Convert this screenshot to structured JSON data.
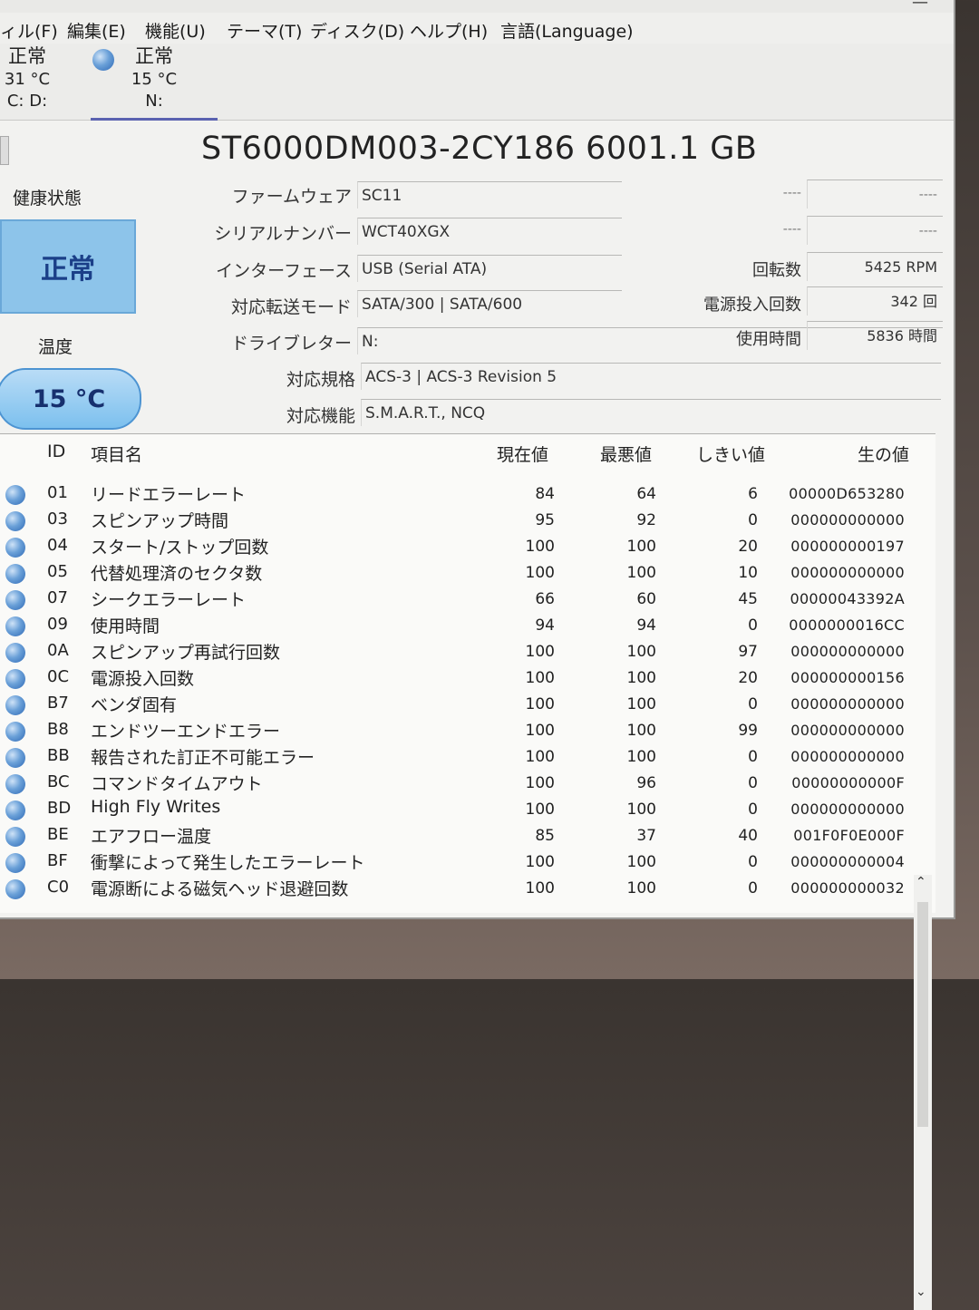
{
  "window": {
    "title_fragment": "",
    "close_glyph": "—"
  },
  "menu": {
    "items": [
      "ィル(F)",
      "編集(E)",
      "機能(U)",
      "テーマ(T)",
      "ディスク(D)",
      "ヘルプ(H)",
      "言語(Language)"
    ]
  },
  "drive_tabs": [
    {
      "status": "正常",
      "temp": "31 °C",
      "letters": "C: D:"
    },
    {
      "status": "正常",
      "temp": "15 °C",
      "letters": "N:"
    }
  ],
  "model_title": "ST6000DM003-2CY186 6001.1 GB",
  "health": {
    "label": "健康状態",
    "value": "正常",
    "color": "#8dc4ea"
  },
  "temperature": {
    "label": "温度",
    "value": "15 °C"
  },
  "info": {
    "firmware": {
      "label": "ファームウェア",
      "value": "SC11"
    },
    "serial": {
      "label": "シリアルナンバー",
      "value": "WCT40XGX"
    },
    "interface": {
      "label": "インターフェース",
      "value": "USB (Serial ATA)"
    },
    "transfer_mode": {
      "label": "対応転送モード",
      "value": "SATA/300 | SATA/600"
    },
    "drive_letter": {
      "label": "ドライブレター",
      "value": "N:"
    },
    "standard": {
      "label": "対応規格",
      "value": "ACS-3 | ACS-3 Revision 5"
    },
    "features": {
      "label": "対応機能",
      "value": "S.M.A.R.T., NCQ"
    }
  },
  "right_info": {
    "r1": {
      "label": "----",
      "value": "----"
    },
    "r2": {
      "label": "----",
      "value": "----"
    },
    "rotation": {
      "label": "回転数",
      "value": "5425 RPM"
    },
    "power_on_count": {
      "label": "電源投入回数",
      "value": "342 回"
    },
    "power_on_hours": {
      "label": "使用時間",
      "value": "5836 時間"
    }
  },
  "smart": {
    "headers": {
      "id": "ID",
      "name": "項目名",
      "current": "現在値",
      "worst": "最悪値",
      "threshold": "しきい値",
      "raw": "生の値"
    },
    "rows": [
      {
        "id": "01",
        "name": "リードエラーレート",
        "current": "84",
        "worst": "64",
        "threshold": "6",
        "raw": "00000D653280"
      },
      {
        "id": "03",
        "name": "スピンアップ時間",
        "current": "95",
        "worst": "92",
        "threshold": "0",
        "raw": "000000000000"
      },
      {
        "id": "04",
        "name": "スタート/ストップ回数",
        "current": "100",
        "worst": "100",
        "threshold": "20",
        "raw": "000000000197"
      },
      {
        "id": "05",
        "name": "代替処理済のセクタ数",
        "current": "100",
        "worst": "100",
        "threshold": "10",
        "raw": "000000000000"
      },
      {
        "id": "07",
        "name": "シークエラーレート",
        "current": "66",
        "worst": "60",
        "threshold": "45",
        "raw": "00000043392A"
      },
      {
        "id": "09",
        "name": "使用時間",
        "current": "94",
        "worst": "94",
        "threshold": "0",
        "raw": "0000000016CC"
      },
      {
        "id": "0A",
        "name": "スピンアップ再試行回数",
        "current": "100",
        "worst": "100",
        "threshold": "97",
        "raw": "000000000000"
      },
      {
        "id": "0C",
        "name": "電源投入回数",
        "current": "100",
        "worst": "100",
        "threshold": "20",
        "raw": "000000000156"
      },
      {
        "id": "B7",
        "name": "ベンダ固有",
        "current": "100",
        "worst": "100",
        "threshold": "0",
        "raw": "000000000000"
      },
      {
        "id": "B8",
        "name": "エンドツーエンドエラー",
        "current": "100",
        "worst": "100",
        "threshold": "99",
        "raw": "000000000000"
      },
      {
        "id": "BB",
        "name": "報告された訂正不可能エラー",
        "current": "100",
        "worst": "100",
        "threshold": "0",
        "raw": "000000000000"
      },
      {
        "id": "BC",
        "name": "コマンドタイムアウト",
        "current": "100",
        "worst": "96",
        "threshold": "0",
        "raw": "00000000000F"
      },
      {
        "id": "BD",
        "name": "High Fly Writes",
        "current": "100",
        "worst": "100",
        "threshold": "0",
        "raw": "000000000000"
      },
      {
        "id": "BE",
        "name": "エアフロー温度",
        "current": "85",
        "worst": "37",
        "threshold": "40",
        "raw": "001F0F0E000F"
      },
      {
        "id": "BF",
        "name": "衝撃によって発生したエラーレート",
        "current": "100",
        "worst": "100",
        "threshold": "0",
        "raw": "000000000004"
      },
      {
        "id": "C0",
        "name": "電源断による磁気ヘッド退避回数",
        "current": "100",
        "worst": "100",
        "threshold": "0",
        "raw": "000000000032"
      }
    ]
  }
}
